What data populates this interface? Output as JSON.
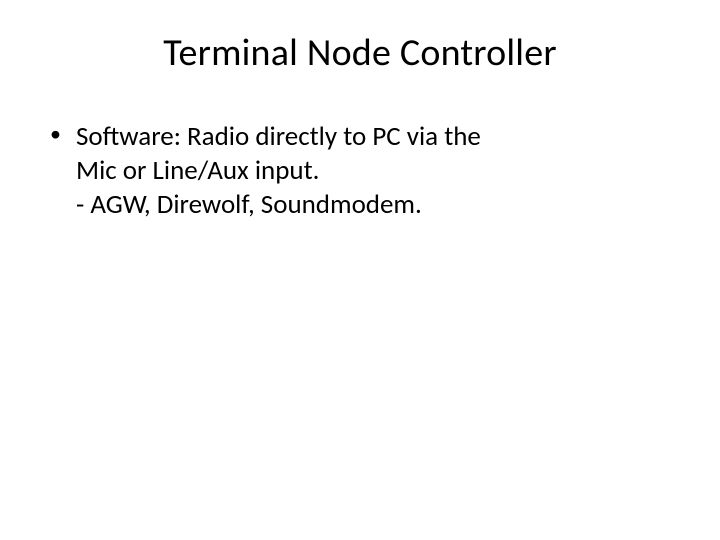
{
  "title": "Terminal Node Controller",
  "bullets": [
    {
      "line1": "Software: Radio directly to PC via the",
      "line2": "Mic or Line/Aux input.",
      "line3": "- AGW, Direwolf, Soundmodem."
    }
  ]
}
